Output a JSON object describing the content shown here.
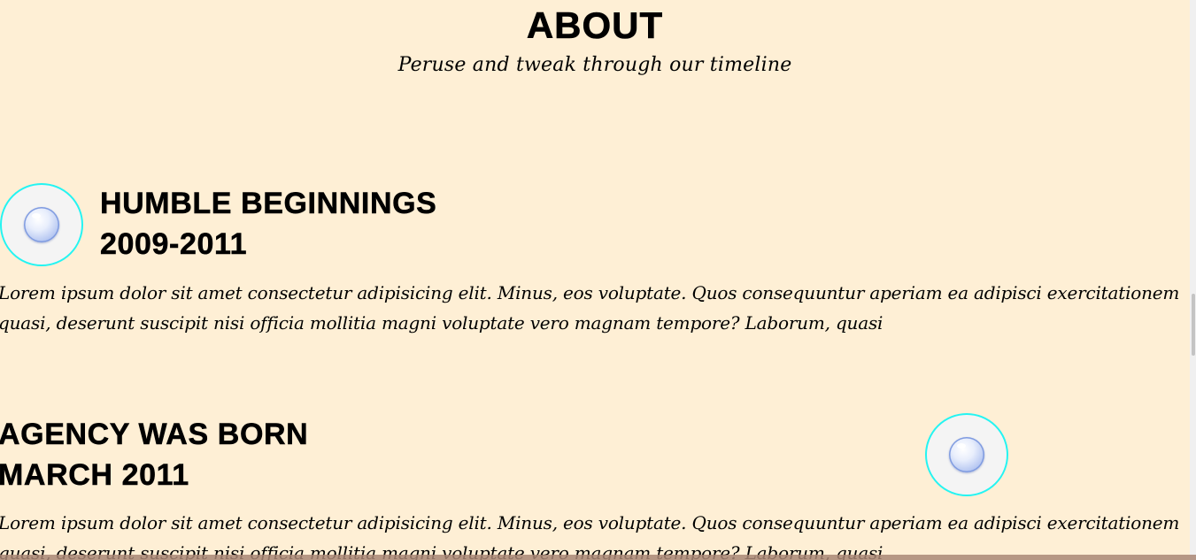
{
  "header": {
    "title": "ABOUT",
    "subtitle": "Peruse and tweak through our timeline"
  },
  "timeline": [
    {
      "title": "HUMBLE BEGINNINGS",
      "date": "2009-2011",
      "text_line1": "Lorem ipsum dolor sit amet consectetur adipisicing elit. Minus, eos voluptate. Quos consequuntur aperiam ea adipisci exercitationem",
      "text_line2": "quasi, deserunt suscipit nisi officia mollitia magni voluptate vero magnam tempore? Laborum, quasi",
      "icon": "bubble-icon"
    },
    {
      "title": "AGENCY WAS BORN",
      "date": "MARCH 2011",
      "text_line1": "Lorem ipsum dolor sit amet consectetur adipisicing elit. Minus, eos voluptate. Quos consequuntur aperiam ea adipisci exercitationem",
      "text_line2": "quasi, deserunt suscipit nisi officia mollitia magni voluptate vero magnam tempore? Laborum, quasi",
      "icon": "bubble-icon"
    }
  ],
  "colors": {
    "background": "#feefd5",
    "circle_border": "#24f4f2",
    "text": "#000000"
  }
}
